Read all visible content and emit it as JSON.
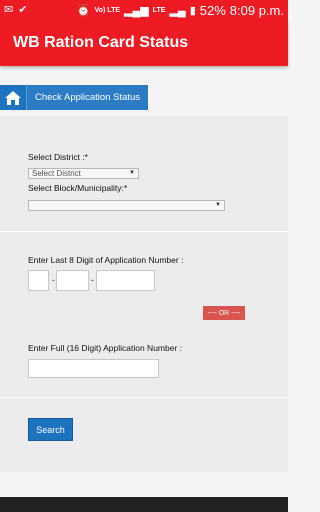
{
  "status_bar": {
    "left_icons": [
      "mail-icon",
      "check-icon"
    ],
    "network_text": "Vo) LTE",
    "lte_text": "LTE",
    "battery_text": "52%",
    "time": "8:09 p.m."
  },
  "app_bar": {
    "title": "WB Ration Card Status"
  },
  "nav": {
    "home_icon": "home-icon",
    "tab_label": "Check Application Status"
  },
  "form": {
    "district_label": "Select District :*",
    "district_selected": "Select District",
    "block_label": "Select Block/Municipality:*",
    "block_selected": "",
    "last8_label": "Enter Last 8 Digit of Application Number :",
    "separator": "-",
    "or_label": "---- OR ----",
    "full_label": "Enter Full (16 Digit) Application Number :",
    "search_button": "Search"
  },
  "colors": {
    "brand_red": "#ee1b24",
    "button_blue": "#1e73be",
    "or_red": "#d9534f"
  }
}
